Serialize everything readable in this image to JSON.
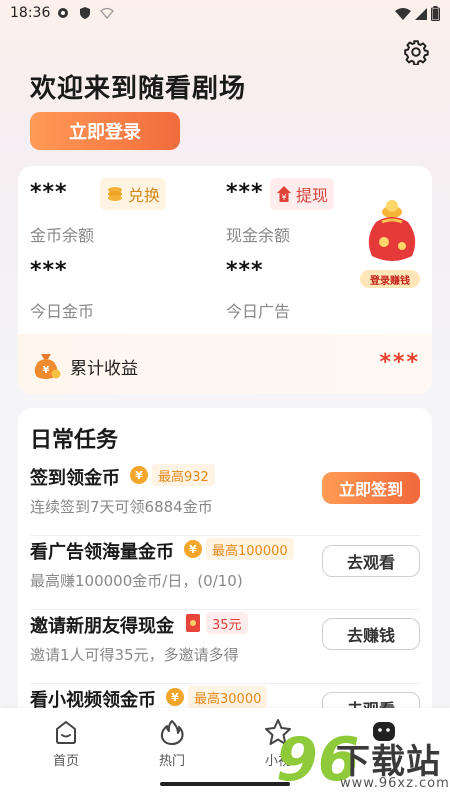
{
  "status_bar": {
    "time": "18:36"
  },
  "header": {
    "title": "欢迎来到随看剧场",
    "login_label": "立即登录"
  },
  "wallet": {
    "coin_balance": {
      "value": "***",
      "label": "金币余额",
      "action": "兑换"
    },
    "cash_balance": {
      "value": "***",
      "label": "现金余额",
      "action": "提现"
    },
    "today_coins": {
      "value": "***",
      "label": "今日金币"
    },
    "today_ads": {
      "value": "***",
      "label": "今日广告"
    },
    "login_earn_caption": "登录赚钱",
    "total_earnings": {
      "label": "累计收益",
      "value": "***"
    }
  },
  "tasks": {
    "title": "日常任务",
    "items": [
      {
        "name": "签到领金币",
        "tag": "最高932",
        "desc": "连续签到7天可领6884金币",
        "action": "立即签到"
      },
      {
        "name": "看广告领海量金币",
        "tag": "最高100000",
        "desc": "最高赚100000金币/日，(0/10)",
        "action": "去观看"
      },
      {
        "name": "邀请新朋友得现金",
        "tag": "35元",
        "desc": "邀请1人可得35元，多邀请多得",
        "action": "去赚钱"
      },
      {
        "name": "看小视频领金币",
        "tag": "最高30000",
        "desc": "",
        "action": "去观看"
      }
    ]
  },
  "nav": {
    "items": [
      {
        "label": "首页",
        "icon": "home-icon"
      },
      {
        "label": "热门",
        "icon": "flame-icon"
      },
      {
        "label": "小视",
        "icon": "star-icon"
      },
      {
        "label": "",
        "icon": "profile-face-icon"
      }
    ]
  },
  "watermark": {
    "number": "96",
    "text": "下载站",
    "url": "www.96xz.com"
  },
  "colors": {
    "accent": "#f26b3c",
    "coin": "#f3a62b",
    "red": "#e8422f"
  }
}
